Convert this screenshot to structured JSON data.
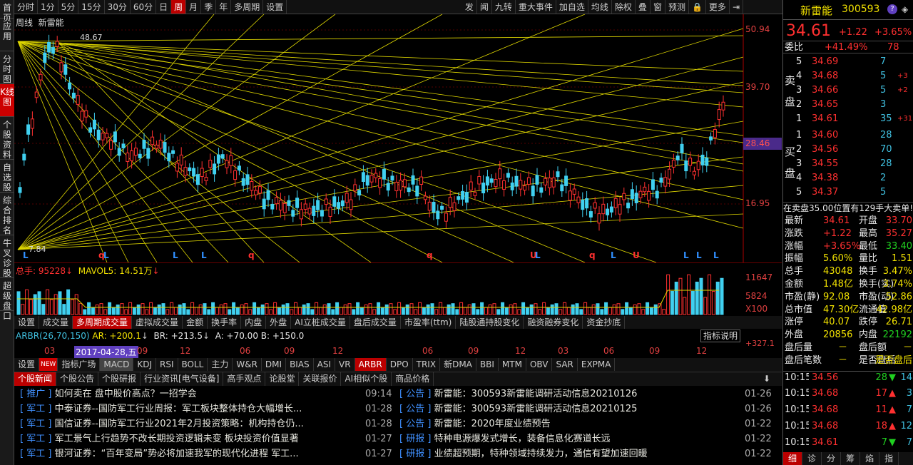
{
  "left_nav": [
    "首页",
    "应用",
    "分时图",
    "K线图",
    "个股资料",
    "自选股",
    "综合排名",
    "牛叉诊股",
    "超级盘口"
  ],
  "toolbar": {
    "left": [
      "分时",
      "1分",
      "5分",
      "15分",
      "30分",
      "60分",
      "日",
      "周",
      "月",
      "季",
      "年",
      "多周期",
      "设置"
    ],
    "right": [
      "发",
      "闻",
      "九转",
      "重大事件",
      "加自选",
      "均线",
      "除权",
      "叠",
      "窗",
      "预测",
      "🔒",
      "更多",
      "⇥"
    ]
  },
  "chart": {
    "title_period": "周线",
    "title_name": "新雷能",
    "high_label": "48.67",
    "low_label": "7.84",
    "price_axis": [
      "50.94",
      "39.70",
      "28.46",
      "16.95"
    ],
    "current_tag": "28.46",
    "markers": [
      "L",
      "q",
      "L",
      "L",
      "L",
      "q",
      "q",
      "U",
      "L",
      "q",
      "L",
      "U",
      "L",
      "L",
      "L"
    ]
  },
  "volume": {
    "label": "总手: 95228",
    "mavol": "MAVOL5: 14.51万",
    "axis": [
      "11647",
      "5824",
      "X100"
    ]
  },
  "indicator_tabs": [
    "设置",
    "成交量",
    "多周期成交量",
    "虚拟成交量",
    "金额",
    "换手率",
    "内盘",
    "外盘",
    "AI立桩成交量",
    "盘后成交量",
    "市盈率(ttm)",
    "陆股通持股变化",
    "融资融券变化",
    "资金抄底"
  ],
  "arbr": {
    "label": "ARBR(26,70,150)",
    "ar": "AR: +200.1",
    "br": "BR: +213.5",
    "a": "A: +70.00",
    "b": "B: +150.0",
    "btn": "指标说明",
    "axis": "+327.1"
  },
  "dates": [
    "03",
    "2017-04-28,五",
    "09",
    "12",
    "06",
    "09",
    "12",
    "06",
    "09",
    "12",
    "03",
    "06",
    "09",
    "12"
  ],
  "indicators2": [
    "设置",
    "NEW",
    "指标广场",
    "MACD",
    "KDJ",
    "RSI",
    "BOLL",
    "主力",
    "W&R",
    "DMI",
    "BIAS",
    "ASI",
    "VR",
    "ARBR",
    "DPO",
    "TRIX",
    "新DMA",
    "BBI",
    "MTM",
    "OBV",
    "SAR",
    "EXPMA"
  ],
  "news_tabs": [
    "个股新闻",
    "个股公告",
    "个股研报",
    "行业资讯[电气设备]",
    "高手观点",
    "论股堂",
    "关联报价",
    "AI相似个股",
    "商品价格"
  ],
  "news_left": [
    {
      "tag": "推广",
      "title": "如何卖在 盘中股价高点？一招学会",
      "date": "09:14"
    },
    {
      "tag": "军工",
      "title": "中泰证券--国防军工行业周报：军工板块整体持仓大幅增长...",
      "date": "01-28"
    },
    {
      "tag": "军工",
      "title": "国信证券--国防军工行业2021年2月投资策略：机构持仓仍...",
      "date": "01-28"
    },
    {
      "tag": "军工",
      "title": "军工景气上行趋势不改长期投资逻辑未变 板块投资价值显著",
      "date": "01-27"
    },
    {
      "tag": "军工",
      "title": "银河证券：“百年变局”势必将加速我军的现代化进程 军工...",
      "date": "01-27"
    }
  ],
  "news_right": [
    {
      "tag": "公告",
      "title": "新雷能：300593新雷能调研活动信息20210126",
      "date": "01-26"
    },
    {
      "tag": "公告",
      "title": "新雷能：300593新雷能调研活动信息20210125",
      "date": "01-26"
    },
    {
      "tag": "公告",
      "title": "新雷能：2020年度业绩预告",
      "date": "01-22"
    },
    {
      "tag": "研报",
      "title": "特种电源爆发式增长，装备信息化赛道长远",
      "date": "01-22"
    },
    {
      "tag": "研报",
      "title": "业绩超预期，特种领域持续发力，通信有望加速回暖",
      "date": "01-22"
    }
  ],
  "quote": {
    "name": "新雷能",
    "code": "300593",
    "price": "34.61",
    "change": "+1.22",
    "pct": "+3.65%",
    "webi_label": "委比",
    "webi": "+41.49%",
    "webi_val": "78",
    "sell": [
      {
        "n": "5",
        "p": "34.69",
        "v": "7",
        "d": ""
      },
      {
        "n": "4",
        "p": "34.68",
        "v": "5",
        "d": "+3"
      },
      {
        "n": "3",
        "p": "34.66",
        "v": "5",
        "d": "+2"
      },
      {
        "n": "2",
        "p": "34.65",
        "v": "3",
        "d": ""
      },
      {
        "n": "1",
        "p": "34.61",
        "v": "35",
        "d": "+31"
      }
    ],
    "buy": [
      {
        "n": "1",
        "p": "34.60",
        "v": "28"
      },
      {
        "n": "2",
        "p": "34.56",
        "v": "70"
      },
      {
        "n": "3",
        "p": "34.55",
        "v": "28"
      },
      {
        "n": "4",
        "p": "34.38",
        "v": "2"
      },
      {
        "n": "5",
        "p": "34.37",
        "v": "5"
      }
    ],
    "sell_label": "卖盘",
    "buy_label": "买盘",
    "notice": "在卖盘35.00位置有129手大卖单!",
    "stats": [
      [
        "最新",
        "34.61",
        "开盘",
        "33.70"
      ],
      [
        "涨跌",
        "+1.22",
        "最高",
        "35.27"
      ],
      [
        "涨幅",
        "+3.65%",
        "最低",
        "33.40"
      ],
      [
        "振幅",
        "5.60%",
        "量比",
        "1.51"
      ],
      [
        "总手",
        "43048",
        "换手",
        "3.47%"
      ],
      [
        "金额",
        "1.48亿",
        "换手(实)",
        "3.74%"
      ],
      [
        "市盈(静)",
        "92.08",
        "市盈(动)",
        "52.86"
      ],
      [
        "总市值",
        "47.30亿",
        "流通值",
        "42.98亿"
      ],
      [
        "涨停",
        "40.07",
        "跌停",
        "26.71"
      ],
      [
        "外盘",
        "20856",
        "内盘",
        "22192"
      ],
      [
        "盘后量",
        "－",
        "盘后额",
        "－"
      ],
      [
        "盘后笔数",
        "－",
        "是否盘后",
        "是否盘后"
      ]
    ],
    "ticks": [
      {
        "t": "10:15",
        "p": "34.56",
        "v": "28",
        "dir": "down",
        "n": "14"
      },
      {
        "t": "10:15",
        "p": "34.68",
        "v": "17",
        "dir": "up",
        "n": "3"
      },
      {
        "t": "10:15",
        "p": "34.68",
        "v": "11",
        "dir": "up",
        "n": "7"
      },
      {
        "t": "10:15",
        "p": "34.68",
        "v": "18",
        "dir": "up",
        "n": "12"
      },
      {
        "t": "10:15",
        "p": "34.61",
        "v": "7",
        "dir": "down",
        "n": "7"
      }
    ],
    "bottom_tabs": [
      "细",
      "诊",
      "分",
      "筹",
      "焰",
      "指"
    ]
  }
}
